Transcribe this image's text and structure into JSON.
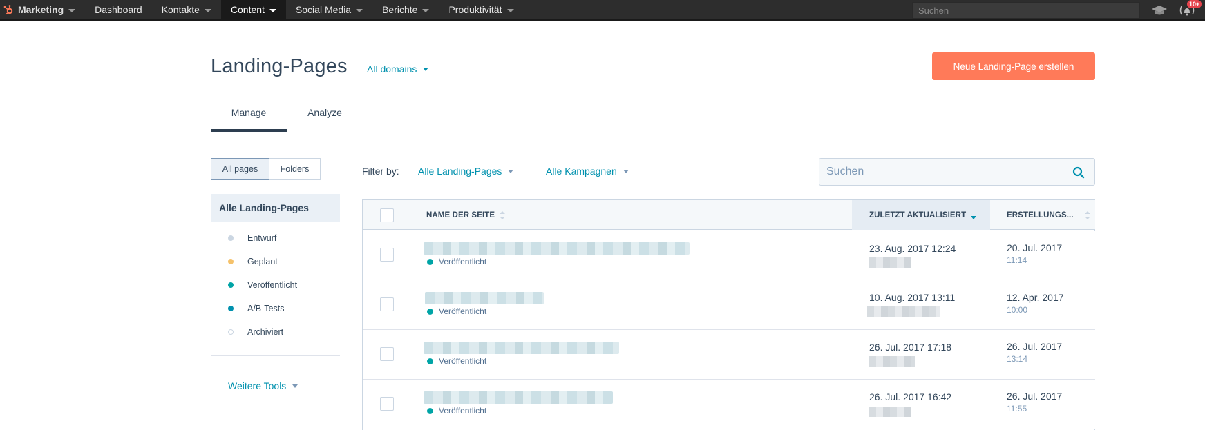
{
  "topnav": {
    "brand": "Marketing",
    "items": [
      {
        "label": "Dashboard",
        "caret": false,
        "active": false
      },
      {
        "label": "Kontakte",
        "caret": true,
        "active": false
      },
      {
        "label": "Content",
        "caret": true,
        "active": true
      },
      {
        "label": "Social Media",
        "caret": true,
        "active": false
      },
      {
        "label": "Berichte",
        "caret": true,
        "active": false
      },
      {
        "label": "Produktivität",
        "caret": true,
        "active": false
      }
    ],
    "search_placeholder": "Suchen",
    "notification_badge": "10+"
  },
  "header": {
    "title": "Landing-Pages",
    "domain_filter": "All domains",
    "create_button": "Neue Landing-Page erstellen"
  },
  "tabs": [
    {
      "label": "Manage",
      "active": true
    },
    {
      "label": "Analyze",
      "active": false
    }
  ],
  "sidebar": {
    "segmented": [
      "All pages",
      "Folders"
    ],
    "header": "Alle Landing-Pages",
    "items": [
      {
        "label": "Entwurf",
        "color": "#cbd6e2"
      },
      {
        "label": "Geplant",
        "color": "#f5c26b"
      },
      {
        "label": "Veröffentlicht",
        "color": "#00a4a6"
      },
      {
        "label": "A/B-Tests",
        "color": "#0091ae"
      },
      {
        "label": "Archiviert",
        "color": "#ffffff"
      }
    ],
    "more_tools": "Weitere Tools"
  },
  "filter": {
    "label": "Filter by:",
    "pages_filter": "Alle Landing-Pages",
    "campaign_filter": "Alle Kampagnen",
    "search_placeholder": "Suchen"
  },
  "table": {
    "columns": [
      "NAME DER SEITE",
      "ZULETZT AKTUALISIERT",
      "ERSTELLUNGS..."
    ],
    "rows": [
      {
        "status": "Veröffentlicht",
        "updated": "23. Aug. 2017 12:24",
        "created_date": "20. Jul. 2017",
        "created_time": "11:14"
      },
      {
        "status": "Veröffentlicht",
        "updated": "10. Aug. 2017 13:11",
        "created_date": "12. Apr. 2017",
        "created_time": "10:00"
      },
      {
        "status": "Veröffentlicht",
        "updated": "26. Jul. 2017 17:18",
        "created_date": "26. Jul. 2017",
        "created_time": "13:14"
      },
      {
        "status": "Veröffentlicht",
        "updated": "26. Jul. 2017 16:42",
        "created_date": "26. Jul. 2017",
        "created_time": "11:55"
      }
    ]
  },
  "colors": {
    "accent": "#ff7a59",
    "link": "#0091ae",
    "published": "#00a4a6",
    "nav_bg": "#2d2d2d"
  }
}
